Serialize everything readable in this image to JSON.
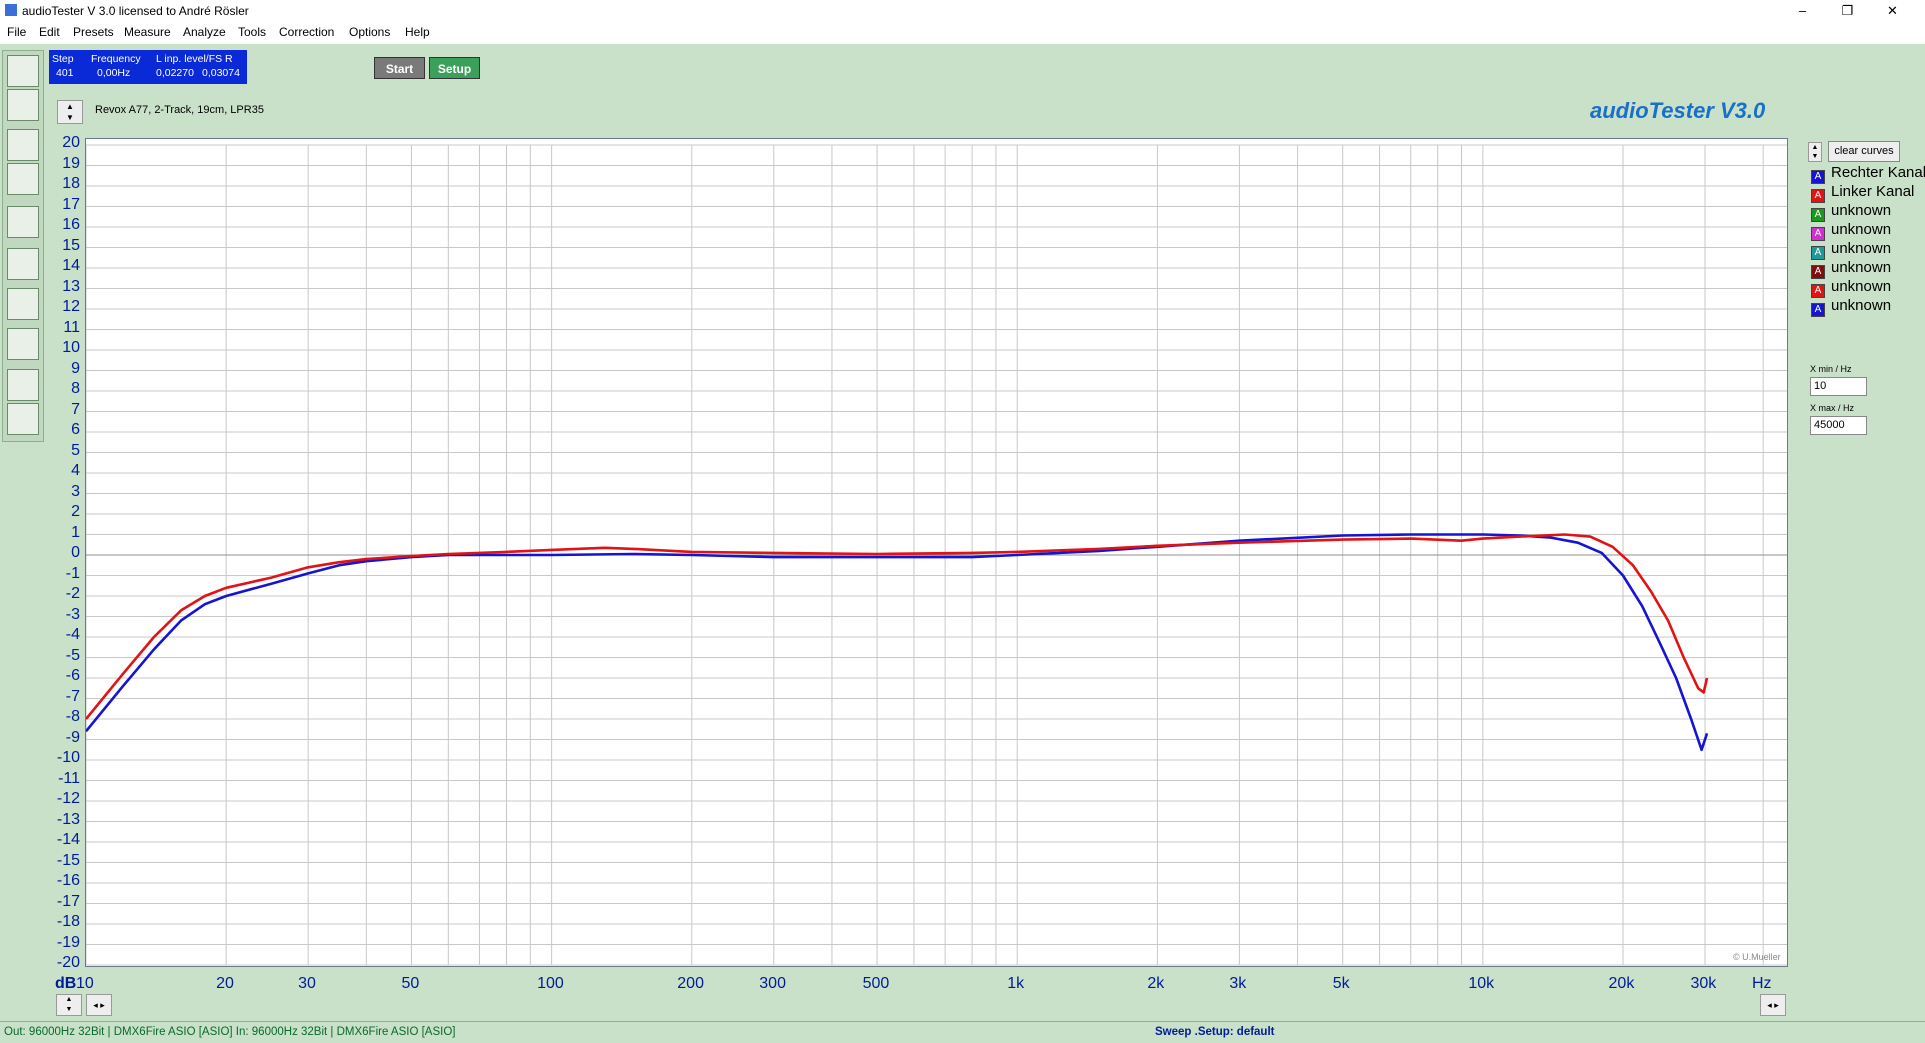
{
  "window": {
    "title": "audioTester  V 3.0   licensed to André Rösler",
    "controls": [
      "–",
      "❐",
      "✕"
    ]
  },
  "menu": [
    "File",
    "Edit",
    "Presets",
    "Measure",
    "Analyze",
    "Tools",
    "Correction",
    "Options",
    "Help"
  ],
  "status": {
    "step_label": "Step",
    "step_value": "401",
    "freq_label": "Frequency",
    "freq_value": "0,00Hz",
    "level_label": "L  inp. level/FS  R",
    "level_l": "0,02270",
    "level_r": "0,03074"
  },
  "buttons": {
    "start": "Start",
    "setup": "Setup"
  },
  "description": "Revox A77, 2-Track, 19cm, LPR35",
  "app_title": "audioTester  V3.0",
  "copyright": "© U.Mueller",
  "legend": {
    "clear": "clear curves",
    "items": [
      {
        "label": "Rechter Kanal",
        "color": "#1414d2",
        "mark": "A"
      },
      {
        "label": "Linker Kanal",
        "color": "#e01414",
        "mark": "A"
      },
      {
        "label": "unknown",
        "color": "#1a9a1a",
        "mark": "A"
      },
      {
        "label": "unknown",
        "color": "#d030d0",
        "mark": "A"
      },
      {
        "label": "unknown",
        "color": "#1a9a9a",
        "mark": "A"
      },
      {
        "label": "unknown",
        "color": "#801010",
        "mark": "A"
      },
      {
        "label": "unknown",
        "color": "#e01414",
        "mark": "A"
      },
      {
        "label": "unknown",
        "color": "#1414d2",
        "mark": "A"
      }
    ],
    "xmin_label": "X min / Hz",
    "xmin": "10",
    "xmax_label": "X max / Hz",
    "xmax": "45000"
  },
  "footer": {
    "left": "Out: 96000Hz 32Bit  | DMX6Fire ASIO [ASIO]   In: 96000Hz 32Bit  | DMX6Fire ASIO [ASIO]",
    "center": "Sweep  .Setup:  default"
  },
  "chart_data": {
    "type": "line",
    "xscale": "log",
    "xlim": [
      10,
      45000
    ],
    "ylim": [
      -20,
      20
    ],
    "ylabel": "dB",
    "xlabel": "Hz",
    "x_ticks": [
      10,
      20,
      30,
      50,
      100,
      200,
      300,
      500,
      1000,
      2000,
      3000,
      5000,
      10000,
      20000,
      30000
    ],
    "x_tick_labels": [
      "10",
      "20",
      "30",
      "50",
      "100",
      "200",
      "300",
      "500",
      "1k",
      "2k",
      "3k",
      "5k",
      "10k",
      "20k",
      "30k"
    ],
    "y_ticks": [
      20,
      19,
      18,
      17,
      16,
      15,
      14,
      13,
      12,
      11,
      10,
      9,
      8,
      7,
      6,
      5,
      4,
      3,
      2,
      1,
      0,
      -1,
      -2,
      -3,
      -4,
      -5,
      -6,
      -7,
      -8,
      -9,
      -10,
      -11,
      -12,
      -13,
      -14,
      -15,
      -16,
      -17,
      -18,
      -19,
      -20
    ],
    "grid": true,
    "series": [
      {
        "name": "Rechter Kanal",
        "color": "#1414d2",
        "points": [
          [
            10,
            -8.6
          ],
          [
            12,
            -6.4
          ],
          [
            14,
            -4.6
          ],
          [
            16,
            -3.2
          ],
          [
            18,
            -2.4
          ],
          [
            20,
            -2.0
          ],
          [
            25,
            -1.4
          ],
          [
            30,
            -0.9
          ],
          [
            35,
            -0.5
          ],
          [
            40,
            -0.3
          ],
          [
            50,
            -0.1
          ],
          [
            60,
            0.0
          ],
          [
            80,
            0.0
          ],
          [
            100,
            0.0
          ],
          [
            150,
            0.05
          ],
          [
            200,
            0.0
          ],
          [
            300,
            -0.1
          ],
          [
            500,
            -0.1
          ],
          [
            800,
            -0.1
          ],
          [
            1000,
            0.0
          ],
          [
            1500,
            0.2
          ],
          [
            2000,
            0.4
          ],
          [
            3000,
            0.7
          ],
          [
            5000,
            0.95
          ],
          [
            7000,
            1.0
          ],
          [
            10000,
            1.0
          ],
          [
            12000,
            0.95
          ],
          [
            14000,
            0.85
          ],
          [
            16000,
            0.6
          ],
          [
            18000,
            0.1
          ],
          [
            20000,
            -1.0
          ],
          [
            22000,
            -2.5
          ],
          [
            24000,
            -4.3
          ],
          [
            26000,
            -6.0
          ],
          [
            28000,
            -8.0
          ],
          [
            29500,
            -9.5
          ],
          [
            30000,
            -9.0
          ],
          [
            30300,
            -8.7
          ]
        ]
      },
      {
        "name": "Linker Kanal",
        "color": "#e01414",
        "points": [
          [
            10,
            -8.0
          ],
          [
            12,
            -5.8
          ],
          [
            14,
            -4.0
          ],
          [
            16,
            -2.7
          ],
          [
            18,
            -2.0
          ],
          [
            20,
            -1.6
          ],
          [
            25,
            -1.1
          ],
          [
            30,
            -0.6
          ],
          [
            35,
            -0.35
          ],
          [
            40,
            -0.2
          ],
          [
            50,
            -0.05
          ],
          [
            60,
            0.05
          ],
          [
            80,
            0.15
          ],
          [
            100,
            0.25
          ],
          [
            130,
            0.35
          ],
          [
            150,
            0.3
          ],
          [
            200,
            0.15
          ],
          [
            300,
            0.1
          ],
          [
            500,
            0.05
          ],
          [
            800,
            0.1
          ],
          [
            1000,
            0.15
          ],
          [
            1500,
            0.3
          ],
          [
            2000,
            0.45
          ],
          [
            3000,
            0.6
          ],
          [
            5000,
            0.75
          ],
          [
            7000,
            0.8
          ],
          [
            9000,
            0.7
          ],
          [
            10000,
            0.8
          ],
          [
            12000,
            0.9
          ],
          [
            15000,
            1.0
          ],
          [
            17000,
            0.9
          ],
          [
            19000,
            0.4
          ],
          [
            21000,
            -0.5
          ],
          [
            23000,
            -1.8
          ],
          [
            25000,
            -3.2
          ],
          [
            27000,
            -5.0
          ],
          [
            29000,
            -6.5
          ],
          [
            29800,
            -6.7
          ],
          [
            30300,
            -6.0
          ]
        ]
      }
    ]
  }
}
